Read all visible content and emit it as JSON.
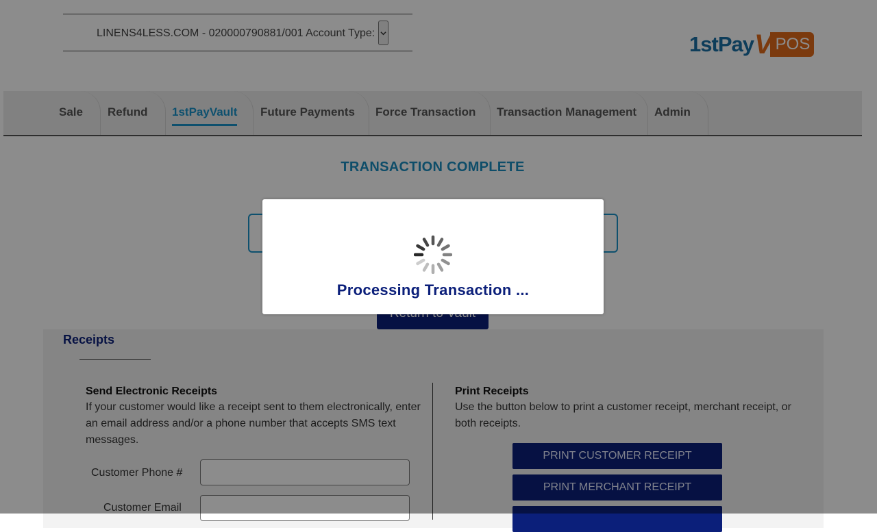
{
  "header": {
    "account_text": "LINENS4LESS.COM - 020000790881/001 Account Type:",
    "logo": {
      "part1": "1st",
      "part2": "Pay",
      "part3": "V",
      "part4": "POS",
      "brand_blue": "#1a6fa5",
      "brand_orange": "#e06a1b"
    }
  },
  "nav": {
    "tabs": [
      {
        "label": "Sale",
        "active": false
      },
      {
        "label": "Refund",
        "active": false
      },
      {
        "label": "1stPayVault",
        "active": true
      },
      {
        "label": "Future Payments",
        "active": false
      },
      {
        "label": "Force Transaction",
        "active": false
      },
      {
        "label": "Transaction Management",
        "active": false
      },
      {
        "label": "Admin",
        "active": false
      }
    ],
    "active_color": "#1b93c9"
  },
  "main": {
    "title": "TRANSACTION COMPLETE",
    "return_button": "Return to Vault"
  },
  "receipts": {
    "title": "Receipts",
    "electronic": {
      "heading": "Send Electronic Receipts",
      "description_lines": [
        "If your customer would like a receipt sent to them electronically, enter",
        "an email address and/or a phone number that accepts SMS text",
        "messages."
      ],
      "phone_label": "Customer Phone #",
      "phone_value": "",
      "email_label": "Customer Email",
      "email_value": ""
    },
    "print": {
      "heading": "Print Receipts",
      "description_lines": [
        "Use the button below to print a customer receipt, merchant receipt, or",
        "both receipts."
      ],
      "buttons": [
        "PRINT CUSTOMER RECEIPT",
        "PRINT MERCHANT RECEIPT",
        ""
      ]
    }
  },
  "modal": {
    "message": "Processing Transaction ...",
    "icon": "loading-spinner-icon"
  },
  "colors": {
    "navy": "#0b1f7a",
    "accent": "#1b93c9"
  }
}
